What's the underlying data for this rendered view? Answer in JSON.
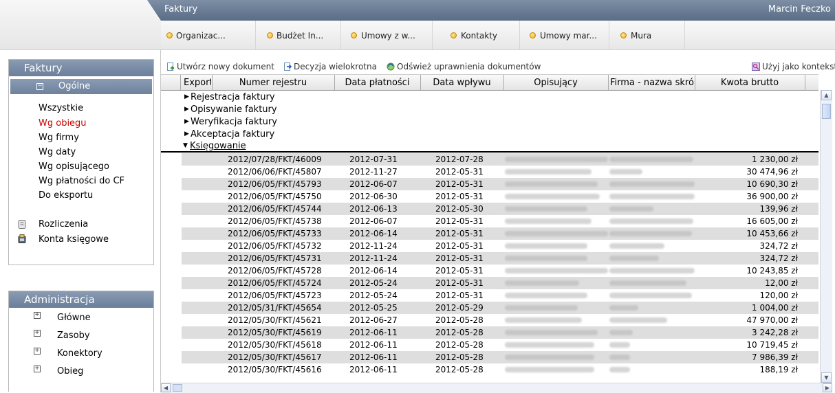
{
  "header": {
    "app_title": "Faktury",
    "user_name": "Marcin Feczko"
  },
  "tabs": [
    {
      "label": "Organizac..."
    },
    {
      "label": "Budżet In..."
    },
    {
      "label": "Umowy z w..."
    },
    {
      "label": "Kontakty"
    },
    {
      "label": "Umowy mar..."
    },
    {
      "label": "Mura"
    }
  ],
  "sidebar": {
    "faktury_title": "Faktury",
    "ogolne_label": "Ogólne",
    "ogolne_toggle": "−",
    "links": [
      "Wszystkie",
      "Wg obiegu",
      "Wg firmy",
      "Wg daty",
      "Wg opisującego",
      "Wg płatności do CF",
      "Do eksportu"
    ],
    "active_link": "Wg obiegu",
    "extra": [
      {
        "label": "Rozliczenia",
        "icon": "document-icon"
      },
      {
        "label": "Konta księgowe",
        "icon": "ledger-icon"
      }
    ],
    "admin_title": "Administracja",
    "admin_toggle": "+",
    "admin_items": [
      "Główne",
      "Zasoby",
      "Konektory",
      "Obieg"
    ]
  },
  "toolbar": {
    "new_document": "Utwórz nowy dokument",
    "multi_decision": "Decyzja wielokrotna",
    "refresh_permissions": "Odśwież uprawnienia dokumentów",
    "use_as_context": "Użyj jako kontekst"
  },
  "grid": {
    "columns": [
      "Export",
      "Numer rejestru",
      "Data płatności",
      "Data wpływu",
      "Opisujący",
      "Firma - nazwa skró",
      "Kwota brutto"
    ],
    "groups_collapsed": [
      "Rejestracja faktury",
      "Opisywanie faktury",
      "Weryfikacja faktury",
      "Akceptacja faktury"
    ],
    "group_open": "Księgowanie",
    "collapsed_arrow": "▶",
    "open_arrow": "▼",
    "rows": [
      {
        "nr": "2012/07/28/FKT/46009",
        "platnosc": "2012-07-31",
        "wplyw": "2012-07-28",
        "kwota": "1 230,00 zł"
      },
      {
        "nr": "2012/06/06/FKT/45807",
        "platnosc": "2012-11-27",
        "wplyw": "2012-05-31",
        "kwota": "30 474,96 zł"
      },
      {
        "nr": "2012/06/05/FKT/45793",
        "platnosc": "2012-06-07",
        "wplyw": "2012-05-31",
        "kwota": "10 690,30 zł"
      },
      {
        "nr": "2012/06/05/FKT/45750",
        "platnosc": "2012-06-30",
        "wplyw": "2012-05-31",
        "kwota": "36 900,00 zł"
      },
      {
        "nr": "2012/06/05/FKT/45744",
        "platnosc": "2012-06-13",
        "wplyw": "2012-05-30",
        "kwota": "139,96 zł"
      },
      {
        "nr": "2012/06/05/FKT/45738",
        "platnosc": "2012-06-07",
        "wplyw": "2012-05-31",
        "kwota": "16 605,00 zł"
      },
      {
        "nr": "2012/06/05/FKT/45733",
        "platnosc": "2012-06-14",
        "wplyw": "2012-05-31",
        "kwota": "10 453,66 zł"
      },
      {
        "nr": "2012/06/05/FKT/45732",
        "platnosc": "2012-11-24",
        "wplyw": "2012-05-31",
        "kwota": "324,72 zł"
      },
      {
        "nr": "2012/06/05/FKT/45731",
        "platnosc": "2012-11-24",
        "wplyw": "2012-05-31",
        "kwota": "324,72 zł"
      },
      {
        "nr": "2012/06/05/FKT/45728",
        "platnosc": "2012-06-14",
        "wplyw": "2012-05-31",
        "kwota": "10 243,85 zł"
      },
      {
        "nr": "2012/06/05/FKT/45724",
        "platnosc": "2012-05-24",
        "wplyw": "2012-05-31",
        "kwota": "12,00 zł"
      },
      {
        "nr": "2012/06/05/FKT/45723",
        "platnosc": "2012-05-24",
        "wplyw": "2012-05-31",
        "kwota": "120,00 zł"
      },
      {
        "nr": "2012/05/31/FKT/45654",
        "platnosc": "2012-05-25",
        "wplyw": "2012-05-29",
        "kwota": "1 004,00 zł"
      },
      {
        "nr": "2012/05/30/FKT/45621",
        "platnosc": "2012-06-27",
        "wplyw": "2012-05-28",
        "kwota": "47 970,00 zł"
      },
      {
        "nr": "2012/05/30/FKT/45619",
        "platnosc": "2012-06-11",
        "wplyw": "2012-05-28",
        "kwota": "3 242,28 zł"
      },
      {
        "nr": "2012/05/30/FKT/45618",
        "platnosc": "2012-06-11",
        "wplyw": "2012-05-28",
        "kwota": "10 719,45 zł"
      },
      {
        "nr": "2012/05/30/FKT/45617",
        "platnosc": "2012-06-11",
        "wplyw": "2012-05-28",
        "kwota": "7 986,39 zł"
      },
      {
        "nr": "2012/05/30/FKT/45616",
        "platnosc": "2012-06-11",
        "wplyw": "2012-05-28",
        "kwota": "188,19 zł"
      }
    ]
  },
  "scrollbars": {
    "up": "▲",
    "down": "▼",
    "left": "◀",
    "right": "▶"
  },
  "colors": {
    "title_bar": "#6b7f9b",
    "active_link": "#cc0000",
    "alt_row": "#dedede",
    "tab_dot": "#f2a800"
  }
}
